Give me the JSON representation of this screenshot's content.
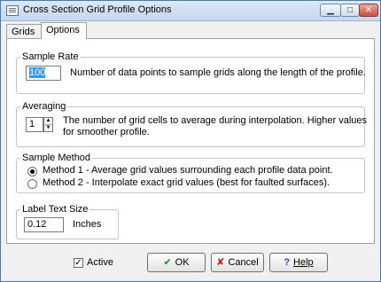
{
  "window": {
    "title": "Cross Section Grid Profile Options",
    "controls": {
      "minimize": "▁",
      "maximize": "□",
      "close": "✕"
    }
  },
  "tabs": [
    {
      "label": "Grids",
      "active": false
    },
    {
      "label": "Options",
      "active": true
    }
  ],
  "sample_rate": {
    "legend": "Sample Rate",
    "value": "100",
    "description": "Number of data points to sample grids along the length of the profile."
  },
  "averaging": {
    "legend": "Averaging",
    "value": "1",
    "description_line1": "The number of  grid cells to average during interpolation. Higher values",
    "description_line2": "for smoother profile."
  },
  "sample_method": {
    "legend": "Sample Method",
    "options": [
      {
        "label": "Method 1 - Average grid values surrounding each profile data point.",
        "selected": true
      },
      {
        "label": "Method 2 - Interpolate exact grid values (best for faulted surfaces).",
        "selected": false
      }
    ]
  },
  "label_text_size": {
    "legend": "Label Text Size",
    "value": "0.12",
    "unit": "Inches"
  },
  "footer": {
    "active_label": "Active",
    "active_checked": true,
    "ok_label": "OK",
    "cancel_label": "Cancel",
    "help_label": "Help"
  },
  "colors": {
    "ok_icon": "#1a8a1a",
    "cancel_icon": "#c0201a",
    "help_icon": "#1f4fb8"
  }
}
